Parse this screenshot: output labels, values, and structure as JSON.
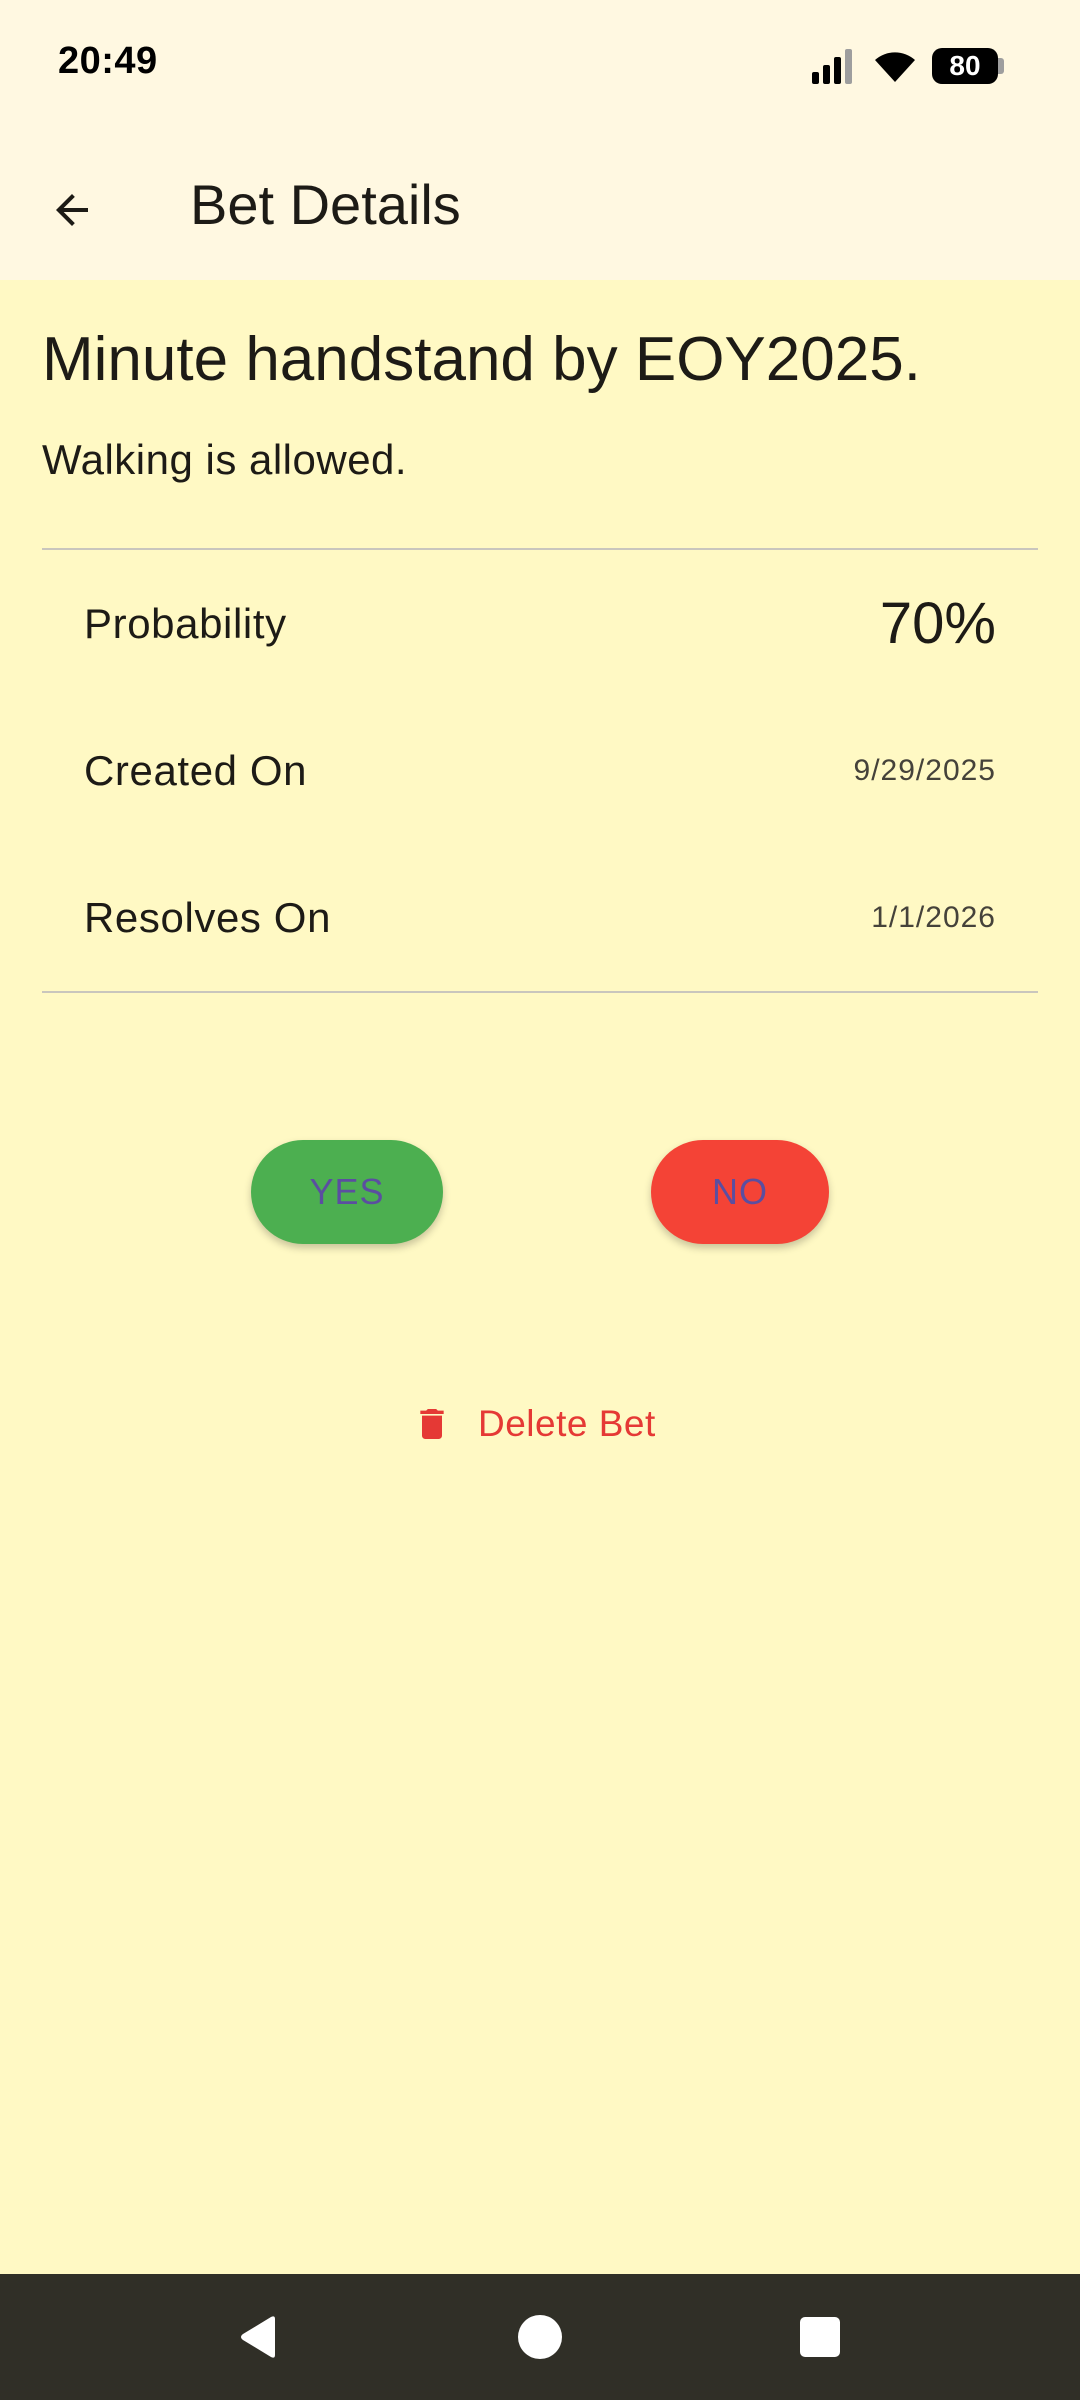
{
  "status_bar": {
    "time": "20:49",
    "battery_level": "80",
    "icons": [
      "signal-icon",
      "wifi-icon",
      "battery-icon"
    ]
  },
  "app_bar": {
    "back_icon": "arrow-back-icon",
    "title": "Bet Details"
  },
  "bet": {
    "title": "Minute handstand by EOY2025.",
    "description": "Walking is allowed."
  },
  "details": [
    {
      "label": "Probability",
      "value": "70%"
    },
    {
      "label": "Created On",
      "value": "9/29/2025"
    },
    {
      "label": "Resolves On",
      "value": "1/1/2026"
    }
  ],
  "actions": {
    "yes_label": "YES",
    "no_label": "NO",
    "delete_label": "Delete Bet",
    "delete_icon": "trash-icon"
  },
  "colors": {
    "background": "#FFF9C4",
    "app_bar": "#FFF8E1",
    "yes": "#4CAF50",
    "no": "#F44336",
    "delete": "#E53935",
    "button_text": "#5B4EA0",
    "nav_bar": "#302F27"
  },
  "nav_bar": {
    "icons": [
      "nav-back-icon",
      "nav-home-icon",
      "nav-recents-icon"
    ]
  }
}
